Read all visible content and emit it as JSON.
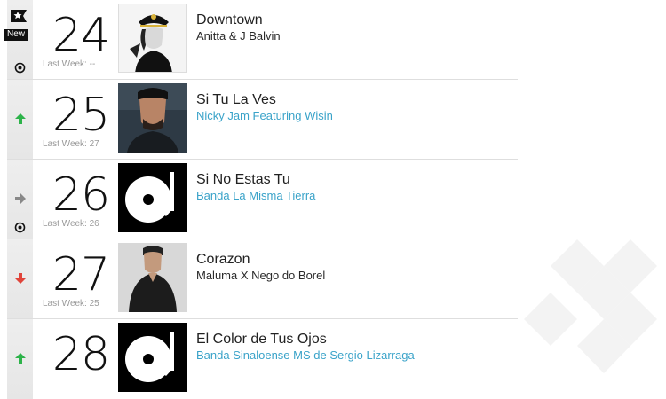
{
  "rows": [
    {
      "rank": "24",
      "last_week": "Last Week: --",
      "title": "Downtown",
      "artist": "Anitta & J Balvin",
      "artist_linked": false,
      "trend": "new",
      "badge": "New"
    },
    {
      "rank": "25",
      "last_week": "Last Week: 27",
      "title": "Si Tu La Ves",
      "artist": "Nicky Jam Featuring Wisin",
      "artist_linked": true,
      "trend": "up"
    },
    {
      "rank": "26",
      "last_week": "Last Week: 26",
      "title": "Si No Estas Tu",
      "artist": "Banda La Misma Tierra",
      "artist_linked": true,
      "trend": "same"
    },
    {
      "rank": "27",
      "last_week": "Last Week: 25",
      "title": "Corazon",
      "artist": "Maluma X Nego do Borel",
      "artist_linked": false,
      "trend": "down"
    },
    {
      "rank": "28",
      "last_week": "",
      "title": "El Color de Tus Ojos",
      "artist": "Banda Sinaloense MS de Sergio Lizarraga",
      "artist_linked": true,
      "trend": "up"
    }
  ],
  "colors": {
    "up": "#2db34a",
    "down": "#e0443a",
    "same": "#888888",
    "link": "#3aa3c9"
  },
  "icons": {
    "up": "arrow-up-icon",
    "down": "arrow-down-icon",
    "same": "arrow-right-icon",
    "new": "star-flag-icon",
    "target": "target-icon"
  }
}
